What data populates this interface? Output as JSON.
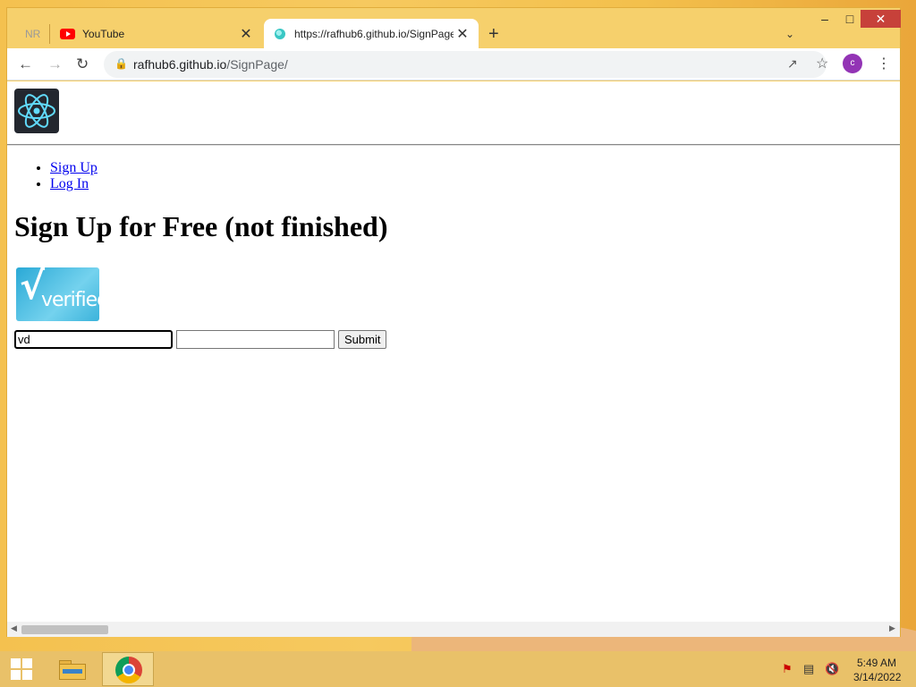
{
  "browser": {
    "tabs": [
      {
        "label": "NR"
      },
      {
        "label": "YouTube"
      },
      {
        "label": "https://rafhub6.github.io/SignPage/"
      }
    ],
    "new_tab_symbol": "+",
    "close_symbol": "✕",
    "address": {
      "host": "rafhub6.github.io",
      "path": "/SignPage/"
    },
    "profile_initial": "c"
  },
  "page": {
    "nav": [
      "Sign Up",
      "Log In"
    ],
    "heading": "Sign Up for Free (not finished)",
    "badge_text": "verified",
    "form": {
      "field1_value": "vd",
      "field2_value": "",
      "submit_label": "Submit"
    }
  },
  "taskbar": {
    "time": "5:49 AM",
    "date": "3/14/2022"
  },
  "colors": {
    "link": "#0000ee",
    "window_close": "#c7413a",
    "profile": "#9334b5",
    "desktop": "#f4c14f"
  }
}
